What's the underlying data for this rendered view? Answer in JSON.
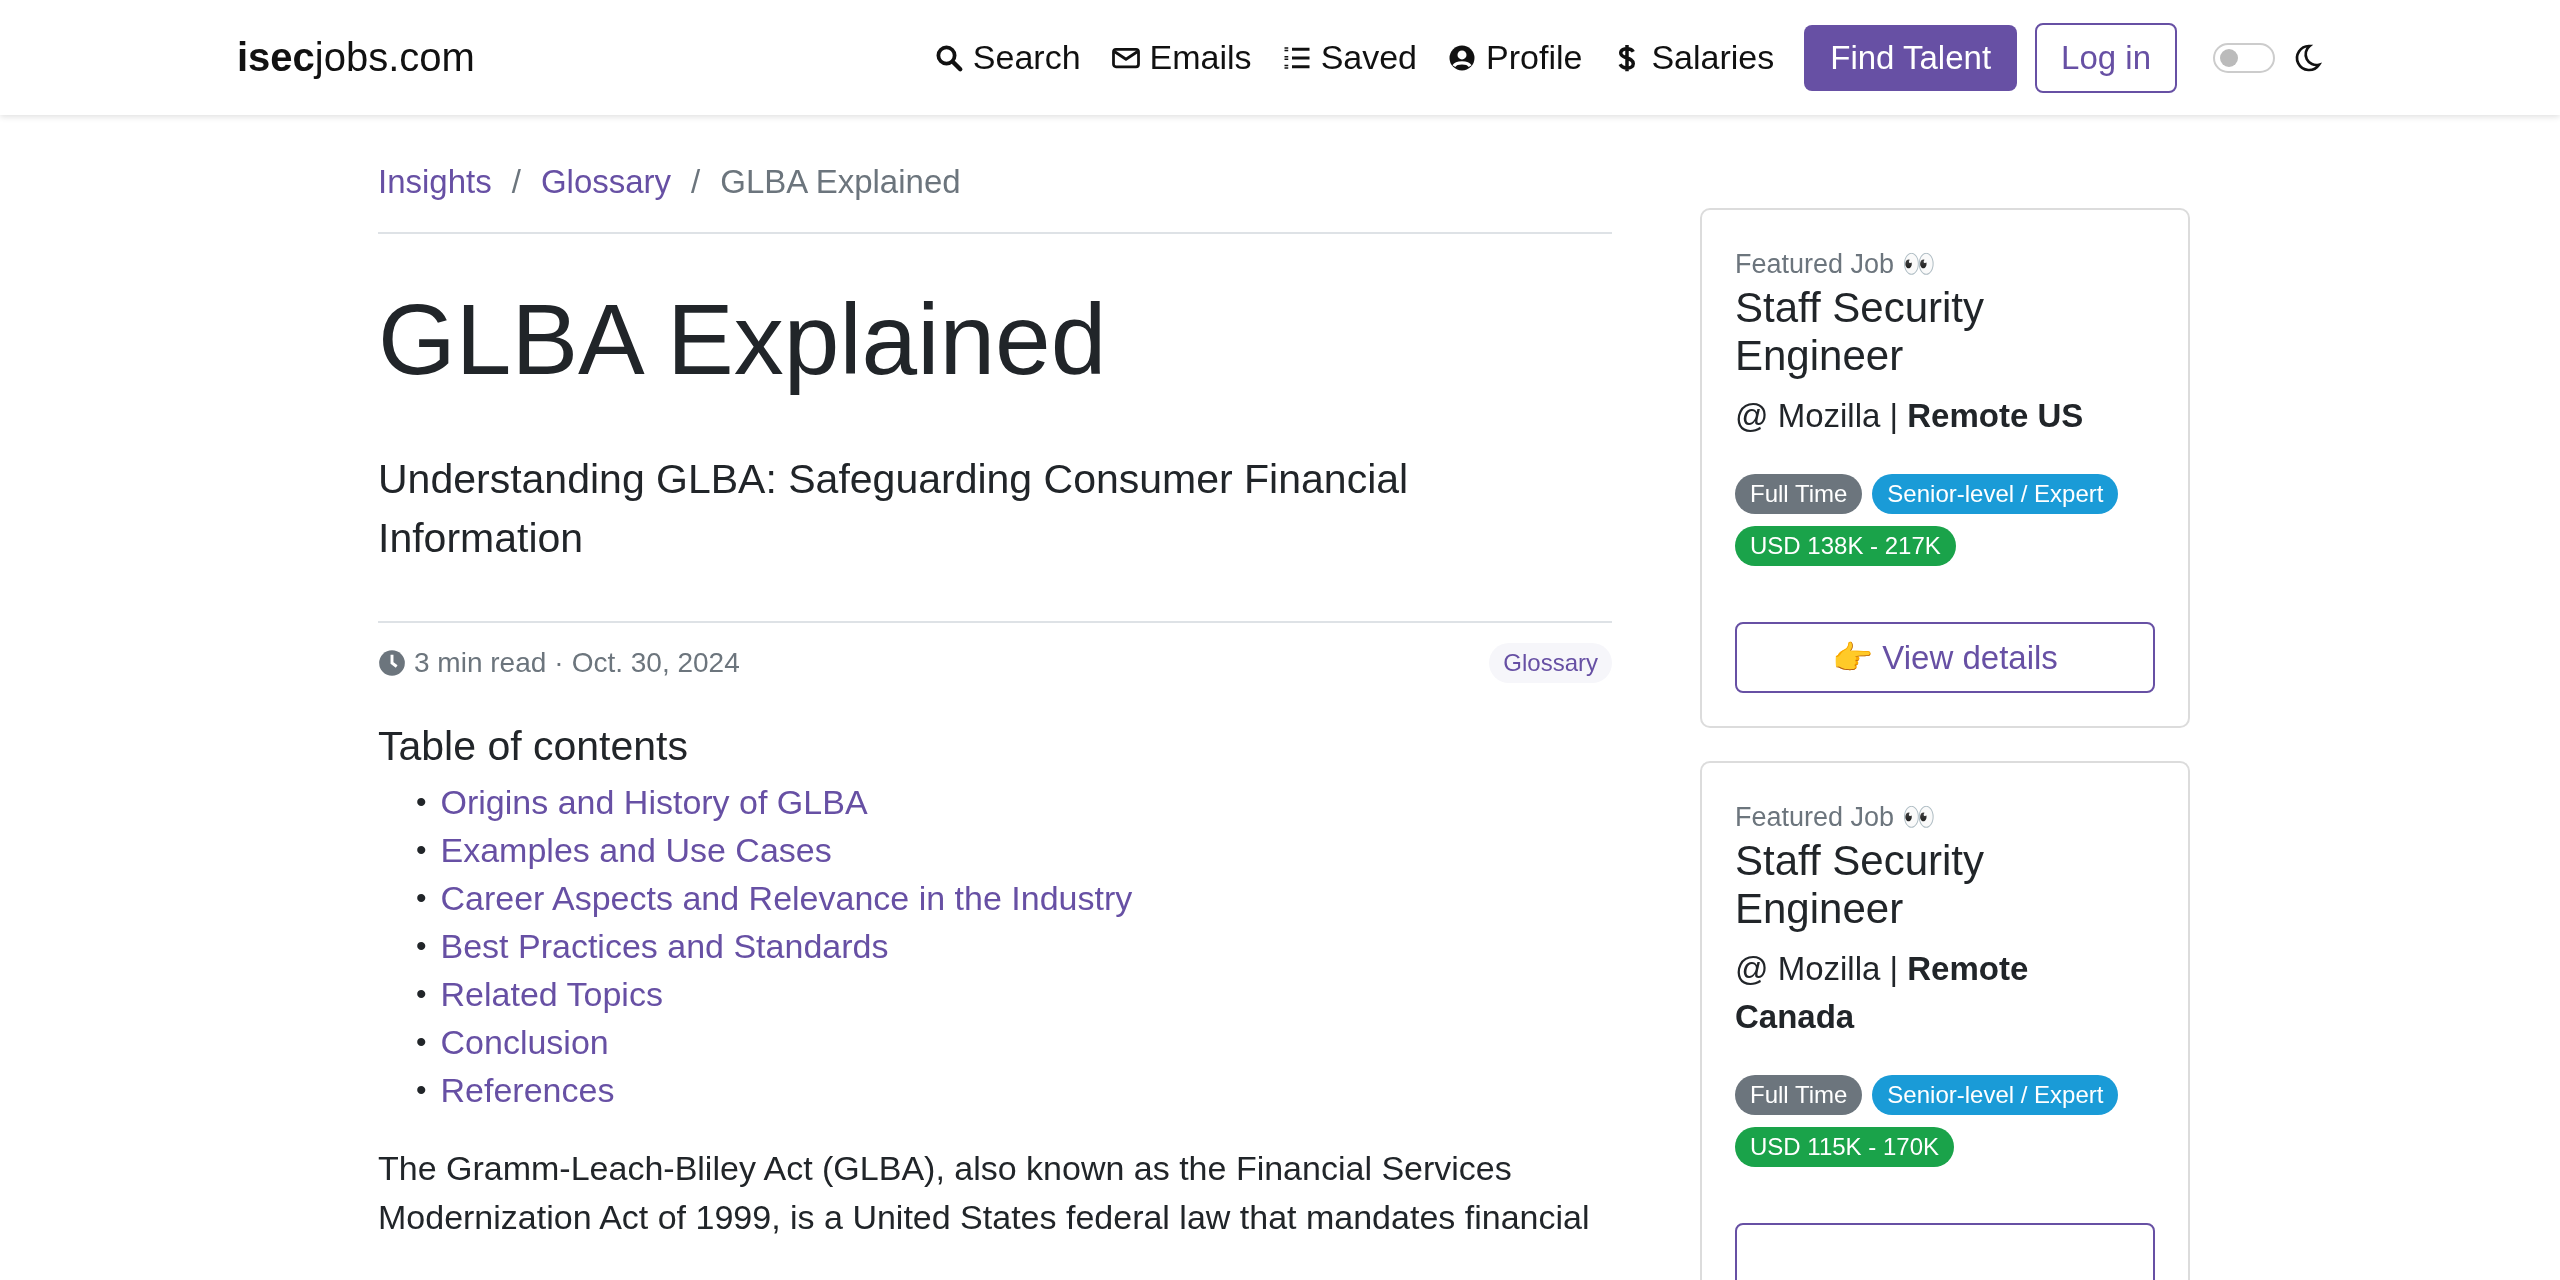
{
  "navbar": {
    "logo": "**isec**jobs.com",
    "links": [
      {
        "kind": "search",
        "label": "Search"
      },
      {
        "kind": "mail",
        "label": "Emails"
      },
      {
        "kind": "list",
        "label": "Saved"
      },
      {
        "kind": "user",
        "label": "Profile"
      },
      {
        "kind": "dollar",
        "label": "Salaries"
      }
    ],
    "find_talent": "Find Talent",
    "login": "Log in",
    "theme_toggle": {
      "on": false
    }
  },
  "breadcrumb": [
    {
      "label": "Insights",
      "link": true
    },
    {
      "separator": "/",
      "label": "Glossary",
      "link": true
    },
    {
      "separator": "/",
      "label": "GLBA Explained",
      "link": false
    }
  ],
  "article": {
    "title": "GLBA Explained",
    "subtitle": "Understanding GLBA: Safeguarding Consumer Financial Information",
    "read_time": "3 min read",
    "meta_separator": "·",
    "date": "Oct. 30, 2024",
    "category": "Glossary",
    "toc_title": "Table of contents",
    "toc": [
      {
        "bullet": "•",
        "label": "Origins and History of GLBA"
      },
      {
        "bullet": "•",
        "label": "Examples and Use Cases"
      },
      {
        "bullet": "•",
        "label": "Career Aspects and Relevance in the Industry"
      },
      {
        "bullet": "•",
        "label": "Best Practices and Standards"
      },
      {
        "bullet": "•",
        "label": "Related Topics"
      },
      {
        "bullet": "•",
        "label": "Conclusion"
      },
      {
        "bullet": "•",
        "label": "References"
      }
    ],
    "intro": "The Gramm-Leach-Bliley Act (GLBA), also known as the Financial Services Modernization Act of 1999, is a United States federal law that mandates financial"
  },
  "featured_jobs": [
    {
      "label": "Featured Job 👀",
      "title": "Staff Security Engineer",
      "company": "@ Mozilla",
      "separator": "|",
      "location": "Remote US",
      "badges": [
        {
          "kind": "type",
          "text": "Full Time"
        },
        {
          "kind": "level",
          "text": "Senior-level / Expert"
        },
        {
          "kind": "salary",
          "text": "USD 138K - 217K"
        }
      ],
      "button": "👉 View details"
    },
    {
      "label": "Featured Job 👀",
      "title": "Staff Security Engineer",
      "company": "@ Mozilla",
      "separator": "|",
      "location": "Remote Canada",
      "badges": [
        {
          "kind": "type",
          "text": "Full Time"
        },
        {
          "kind": "level",
          "text": "Senior-level / Expert"
        },
        {
          "kind": "salary",
          "text": "USD 115K - 170K"
        }
      ]
    }
  ]
}
